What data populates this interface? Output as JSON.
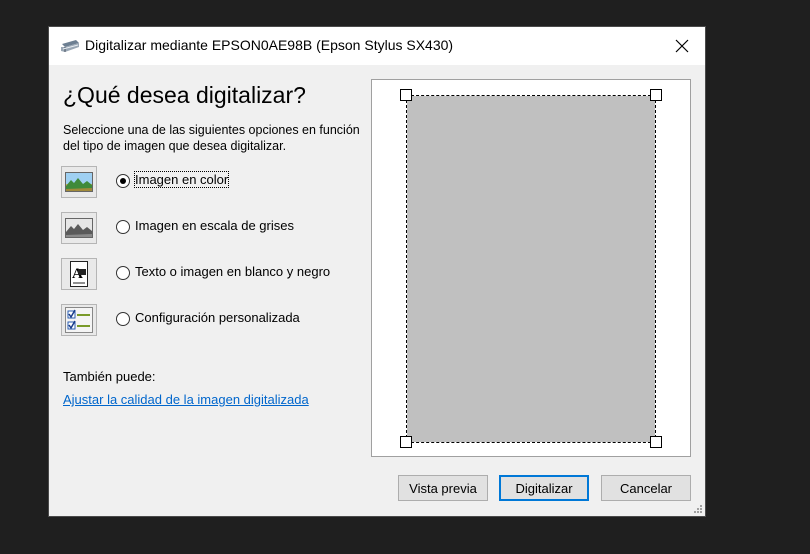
{
  "window": {
    "title": "Digitalizar mediante EPSON0AE98B (Epson Stylus SX430)",
    "close_symbol": "✕"
  },
  "main": {
    "heading": "¿Qué desea digitalizar?",
    "instructions": "Seleccione una de las siguientes opciones en función del tipo de imagen que desea digitalizar.",
    "options": [
      {
        "label": "Imagen en color",
        "icon": "color-picture-icon",
        "selected": true
      },
      {
        "label": "Imagen en escala de grises",
        "icon": "grayscale-picture-icon",
        "selected": false
      },
      {
        "label": "Texto o imagen en blanco y negro",
        "icon": "text-document-icon",
        "selected": false
      },
      {
        "label": "Configuración personalizada",
        "icon": "custom-settings-icon",
        "selected": false
      }
    ],
    "also_label": "También puede:",
    "quality_link": "Ajustar la calidad de la imagen digitalizada"
  },
  "buttons": {
    "preview": "Vista previa",
    "scan": "Digitalizar",
    "cancel": "Cancelar"
  },
  "colors": {
    "link": "#0066cc",
    "default_button_border": "#0078d7",
    "preview_gray": "#c0c0c0"
  }
}
